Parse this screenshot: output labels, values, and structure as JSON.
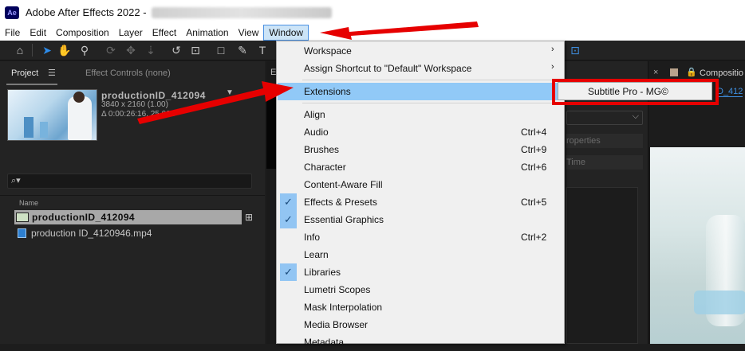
{
  "window": {
    "app_logo": "Ae",
    "title": "Adobe After Effects 2022 -"
  },
  "menubar": {
    "items": [
      "File",
      "Edit",
      "Composition",
      "Layer",
      "Effect",
      "Animation",
      "View",
      "Window"
    ],
    "active": "Window"
  },
  "toolbar": {
    "tools": [
      "home-icon",
      "selection-tool-icon",
      "hand-tool-icon",
      "zoom-tool-icon",
      "orbit-icon",
      "pan-icon",
      "dolly-icon",
      "rotate-icon",
      "anchor-icon",
      "rectangle-icon",
      "pen-icon",
      "type-icon"
    ]
  },
  "project_panel": {
    "tab_project": "Project",
    "tab_menu": "☰",
    "tab_effect_controls": "Effect Controls (none)",
    "comp_name": "productionID_412094",
    "comp_resolution": "3840 x 2160 (1.00)",
    "comp_duration": "Δ 0:00:26:16, 25.00 f",
    "search_icon": "⌕▾",
    "column_name": "Name",
    "items": [
      {
        "name": "productionID_412094",
        "type": "composition"
      },
      {
        "name": "production ID_4120946.mp4",
        "type": "footage"
      }
    ]
  },
  "mid_panel": {
    "label": "E"
  },
  "right_panel": {
    "dropdown_caret": "⌵",
    "properties_label": "roperties",
    "time_label": "Time"
  },
  "comp_panel": {
    "close": "×",
    "tab_label": "Compositio",
    "link_text": "D_412"
  },
  "window_menu": {
    "items": [
      {
        "label": "Workspace",
        "submenu": true
      },
      {
        "label": "Assign Shortcut to \"Default\" Workspace",
        "submenu": true
      },
      {
        "label": "Extensions",
        "submenu": true,
        "highlighted": true
      },
      {
        "label": "Align"
      },
      {
        "label": "Audio",
        "shortcut": "Ctrl+4"
      },
      {
        "label": "Brushes",
        "shortcut": "Ctrl+9"
      },
      {
        "label": "Character",
        "shortcut": "Ctrl+6"
      },
      {
        "label": "Content-Aware Fill"
      },
      {
        "label": "Effects & Presets",
        "shortcut": "Ctrl+5",
        "checked": true
      },
      {
        "label": "Essential Graphics",
        "checked": true
      },
      {
        "label": "Info",
        "shortcut": "Ctrl+2"
      },
      {
        "label": "Learn"
      },
      {
        "label": "Libraries",
        "checked": true
      },
      {
        "label": "Lumetri Scopes"
      },
      {
        "label": "Mask Interpolation"
      },
      {
        "label": "Media Browser"
      },
      {
        "label": "Metadata"
      }
    ],
    "submenu_arrow": "›",
    "check_mark": "✓"
  },
  "extensions_submenu": {
    "items": [
      "Subtitle Pro - MG©"
    ]
  },
  "annotations": {
    "color": "#e60000"
  }
}
